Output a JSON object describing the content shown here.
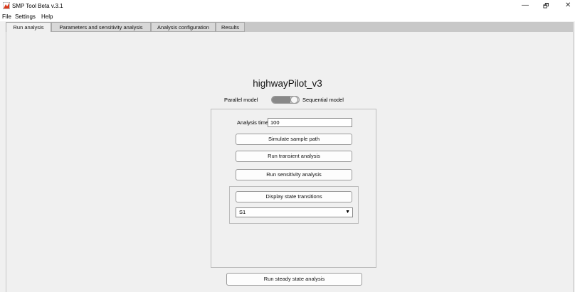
{
  "window": {
    "title": "SMP Tool Beta v.3.1",
    "controls": {
      "minimize": "—",
      "restore": "🗗",
      "close": "✕"
    }
  },
  "menu": [
    "File",
    "Settings",
    "Help"
  ],
  "tabs": [
    {
      "label": "Run analysis",
      "active": true
    },
    {
      "label": "Parameters and sensitivity analysis",
      "active": false
    },
    {
      "label": "Analysis configuration",
      "active": false
    },
    {
      "label": "Results",
      "active": false
    }
  ],
  "main": {
    "model_name": "highwayPilot_v3",
    "toggle": {
      "left_label": "Parallel model",
      "right_label": "Sequential model"
    },
    "analysis_time_label": "Analysis time(s) [h]:",
    "analysis_time_value": "100",
    "buttons": {
      "simulate": "Simulate sample path",
      "transient": "Run transient analysis",
      "sensitivity": "Run sensitivity analysis",
      "display_transitions": "Display state transitions",
      "steady_state": "Run steady state analysis"
    },
    "state_select": {
      "value": "S1"
    }
  }
}
